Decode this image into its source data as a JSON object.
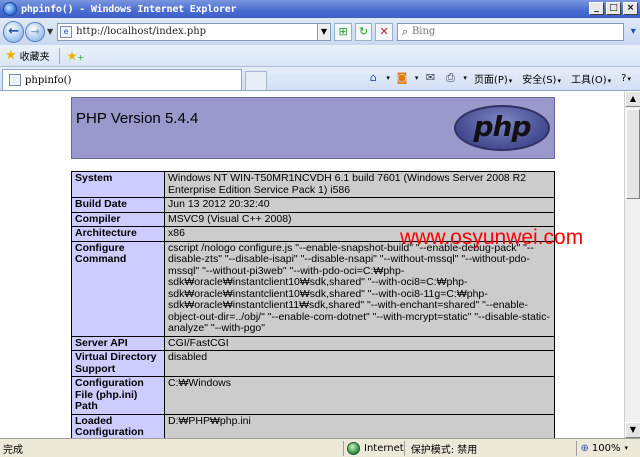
{
  "window": {
    "title": "phpinfo() - Windows Internet Explorer"
  },
  "toolbar": {
    "url": "http://localhost/index.php",
    "search_placeholder": "Bing"
  },
  "favorites": {
    "label": "收藏夹"
  },
  "tab": {
    "label": "phpinfo()"
  },
  "commands": {
    "page": "页面(P)",
    "safety": "安全(S)",
    "tools": "工具(O)",
    "help": "?"
  },
  "php": {
    "version": "PHP Version 5.4.4",
    "logo_text": "php",
    "rows": [
      {
        "key": "System",
        "value": "Windows NT WIN-T50MR1NCVDH 6.1 build 7601 (Windows Server 2008 R2 Enterprise Edition Service Pack 1) i586"
      },
      {
        "key": "Build Date",
        "value": "Jun 13 2012 20:32:40"
      },
      {
        "key": "Compiler",
        "value": "MSVC9 (Visual C++ 2008)"
      },
      {
        "key": "Architecture",
        "value": "x86"
      },
      {
        "key": "Configure Command",
        "value": "cscript /nologo configure.js \"--enable-snapshot-build\" \"--enable-debug-pack\" \"--disable-zts\" \"--disable-isapi\" \"--disable-nsapi\" \"--without-mssql\" \"--without-pdo-mssql\" \"--without-pi3web\" \"--with-pdo-oci=C:₩php-sdk₩oracle₩instantclient10₩sdk,shared\" \"--with-oci8=C:₩php-sdk₩oracle₩instantclient10₩sdk,shared\" \"--with-oci8-11g=C:₩php-sdk₩oracle₩instantclient11₩sdk,shared\" \"--with-enchant=shared\" \"--enable-object-out-dir=../obj/\" \"--enable-com-dotnet\" \"--with-mcrypt=static\" \"--disable-static-analyze\" \"--with-pgo\""
      },
      {
        "key": "Server API",
        "value": "CGI/FastCGI"
      },
      {
        "key": "Virtual Directory Support",
        "value": "disabled"
      },
      {
        "key": "Configuration File (php.ini) Path",
        "value": "C:₩Windows"
      },
      {
        "key": "Loaded Configuration File",
        "value": "D:₩PHP₩php.ini"
      }
    ]
  },
  "watermark": "www.osyunwei.com",
  "status": {
    "text": "完成",
    "zone": "Internet",
    "protected_mode": "保护模式: 禁用",
    "zoom": "100%"
  }
}
